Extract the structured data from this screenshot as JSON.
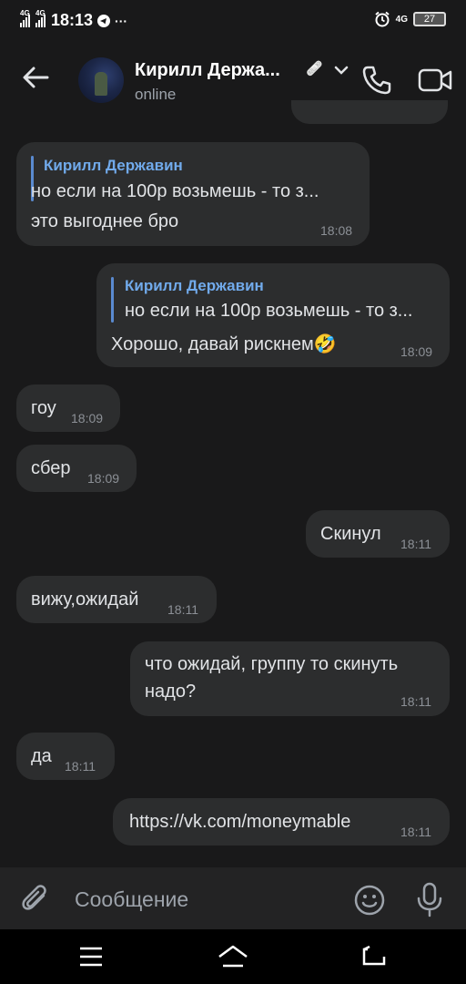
{
  "status_bar": {
    "network1": "4G",
    "network2": "4G",
    "time": "18:13",
    "more": "···",
    "network3": "4G",
    "battery": "27"
  },
  "header": {
    "contact_name": "Кирилл Держа...",
    "status_emoji": "🩹",
    "status": "online"
  },
  "messages": [
    {
      "side": "in",
      "reply_name": "Кирилл Державин",
      "reply_text": "но если на 100р возьмешь - то з...",
      "text": "это выгоднее бро",
      "time": "18:08"
    },
    {
      "side": "out",
      "reply_name": "Кирилл Державин",
      "reply_text": "но если на 100р возьмешь - то з...",
      "text": "Хорошо, давай рискнем🤣",
      "time": "18:09"
    },
    {
      "side": "in",
      "text": "гоу",
      "time": "18:09"
    },
    {
      "side": "in",
      "text": "сбер",
      "time": "18:09"
    },
    {
      "side": "out",
      "text": "Скинул",
      "time": "18:11"
    },
    {
      "side": "in",
      "text": "вижу,ожидай",
      "time": "18:11"
    },
    {
      "side": "out",
      "text_line1": "что ожидай, группу то скинуть",
      "text_line2": "надо?",
      "time": "18:11"
    },
    {
      "side": "in",
      "text": "да",
      "time": "18:11"
    },
    {
      "side": "out",
      "link": "https://vk.com/moneymable",
      "time": "18:11"
    }
  ],
  "composer": {
    "placeholder": "Сообщение"
  },
  "icons": [
    "back-arrow-icon",
    "phone-icon",
    "video-camera-icon",
    "chevron-down-icon",
    "paperclip-icon",
    "smile-icon",
    "microphone-icon",
    "menu-icon",
    "home-icon",
    "back-icon"
  ],
  "colors": {
    "background": "#19191a",
    "bubble": "#2c2d2e",
    "accent": "#71aaeb",
    "text": "#e1e3e6",
    "secondary": "#8c9096"
  }
}
